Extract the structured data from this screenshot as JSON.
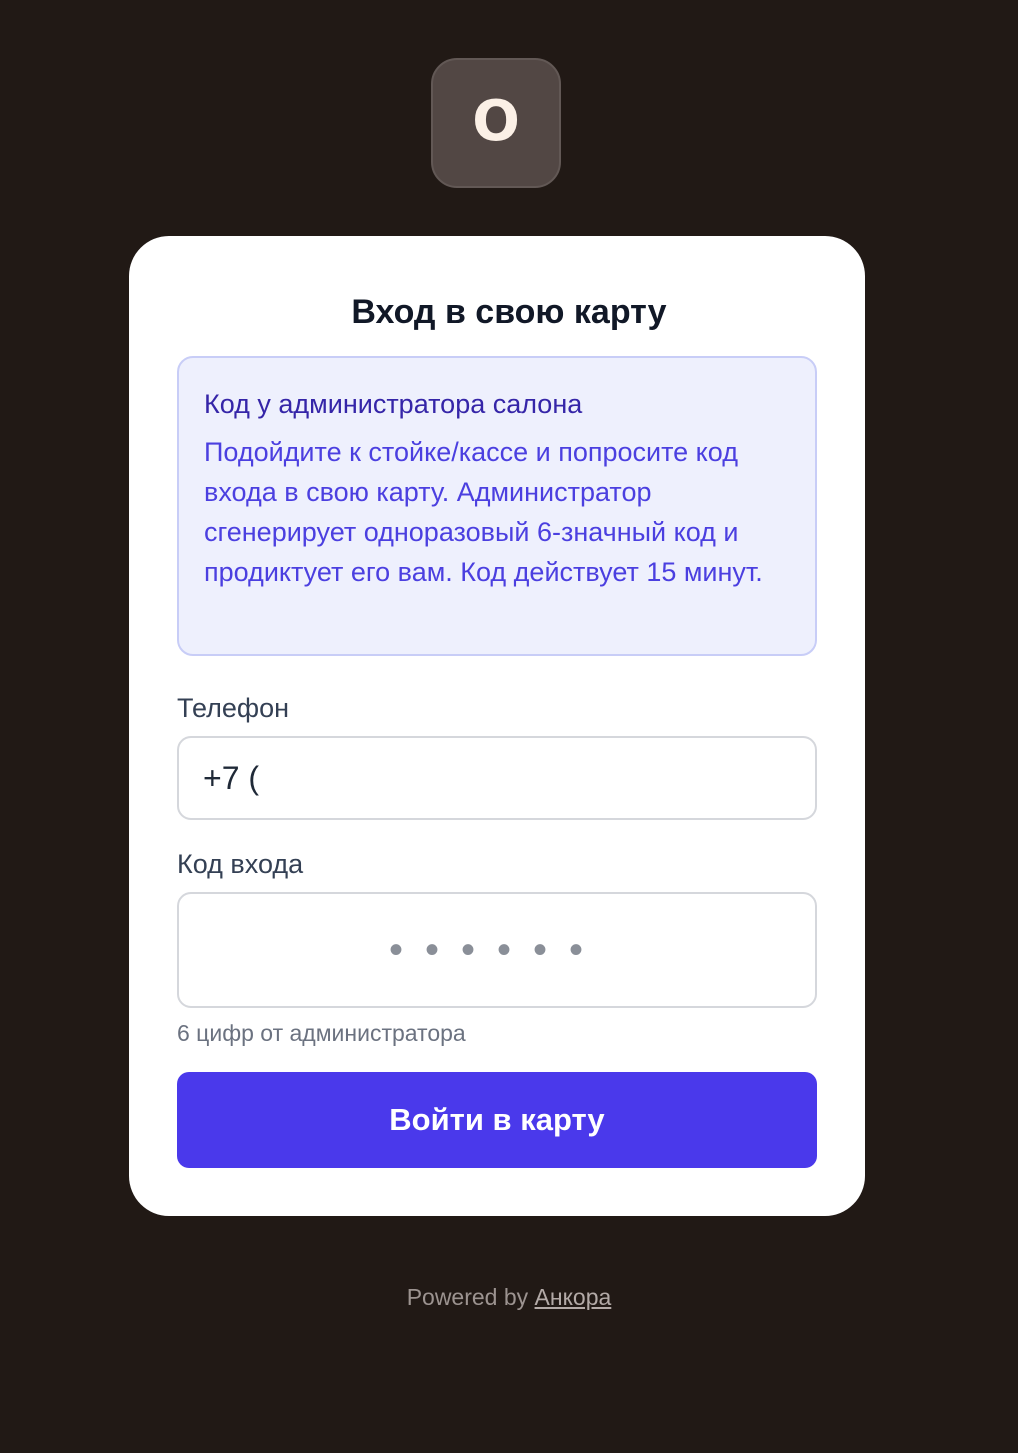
{
  "brand": {
    "logo_letter": "O",
    "logo_bg": "#524744",
    "page_bg": "#211915",
    "accent": "#4a39eb"
  },
  "card": {
    "title": "Вход в свою карту",
    "info": {
      "title": "Код у администратора салона",
      "text": "Подойдите к стойке/кассе и попросите код входа в свою карту. Администратор сгенерирует одноразовый 6-значный код и продиктует его вам. Код действует 15 минут."
    },
    "phone": {
      "label": "Телефон",
      "value": "+7 ("
    },
    "code": {
      "label": "Код входа",
      "placeholder": "••••••",
      "hint": "6 цифр от администратора"
    },
    "submit_label": "Войти в карту"
  },
  "footer": {
    "prefix": "Powered by",
    "link_text": "Анкора"
  }
}
